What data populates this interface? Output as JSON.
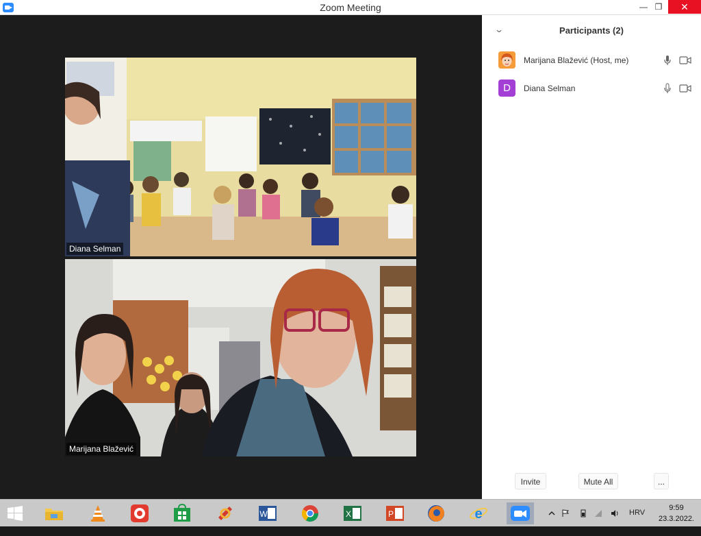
{
  "window": {
    "title": "Zoom Meeting",
    "minimize": "—",
    "maximize": "❐",
    "close": "✕"
  },
  "videos": [
    {
      "name": "Diana Selman"
    },
    {
      "name": "Marijana Blažević"
    }
  ],
  "participants_panel": {
    "title": "Participants (2)",
    "collapse_glyph": "⌄",
    "participants": [
      {
        "name": "Marijana Blažević (Host, me)",
        "avatar_icon": "cartoon-avatar-icon"
      },
      {
        "name": "Diana Selman",
        "avatar_letter": "D",
        "avatar_color": "#a43fd6"
      }
    ],
    "invite_label": "Invite",
    "mute_all_label": "Mute All",
    "more_label": "..."
  },
  "taskbar": {
    "apps": [
      {
        "id": "file-explorer",
        "icon": "folder-icon"
      },
      {
        "id": "vlc",
        "icon": "vlc-cone-icon"
      },
      {
        "id": "screen-recorder",
        "icon": "record-icon"
      },
      {
        "id": "store",
        "icon": "store-icon"
      },
      {
        "id": "ccleaner",
        "icon": "ccleaner-icon"
      },
      {
        "id": "word",
        "icon": "word-icon",
        "letter": "W"
      },
      {
        "id": "chrome",
        "icon": "chrome-icon"
      },
      {
        "id": "excel",
        "icon": "excel-icon",
        "letter": "X"
      },
      {
        "id": "powerpoint",
        "icon": "powerpoint-icon",
        "letter": "P"
      },
      {
        "id": "firefox",
        "icon": "firefox-icon"
      },
      {
        "id": "internet-explorer",
        "icon": "ie-icon",
        "letter": "e"
      },
      {
        "id": "zoom",
        "icon": "zoom-icon",
        "active": true
      }
    ],
    "language": "HRV",
    "time": "9:59",
    "date": "23.3.2022."
  },
  "colors": {
    "accent": "#2d8cff",
    "close_red": "#e81123",
    "avatar_purple": "#a43fd6"
  }
}
